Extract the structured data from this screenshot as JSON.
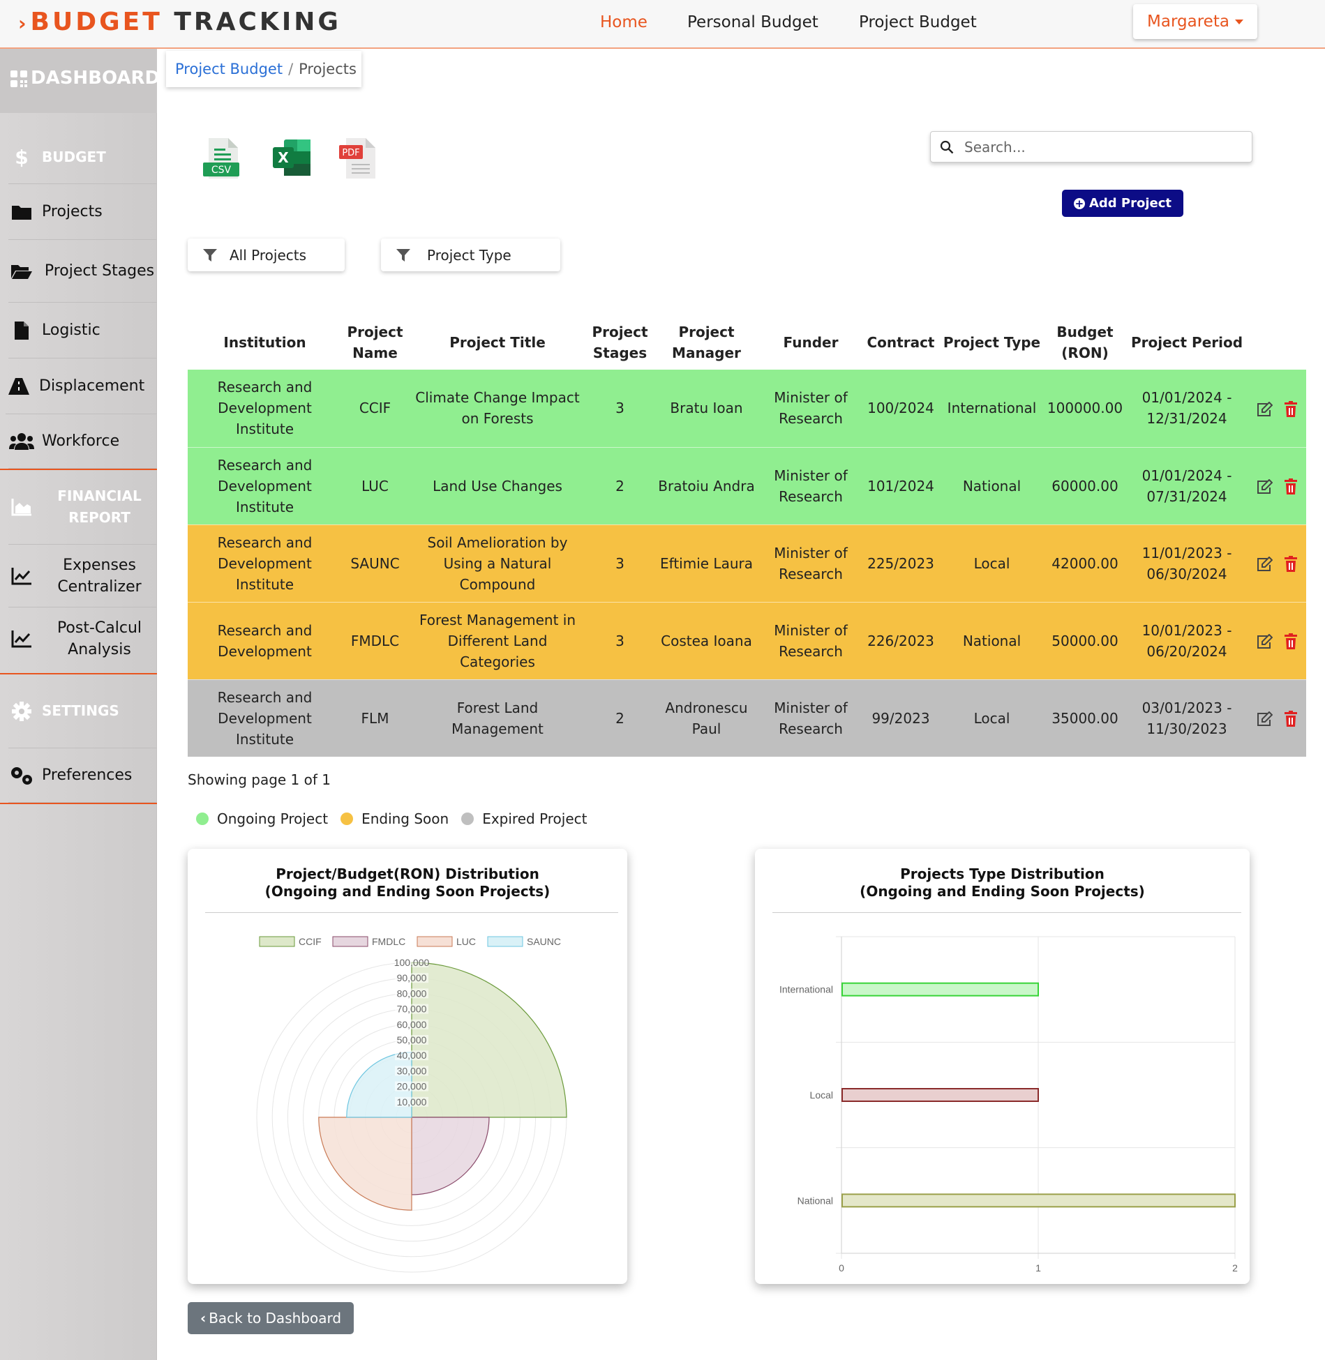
{
  "brand": {
    "prefix": "›",
    "part1": "BUDGET",
    "part2": "TRACKING"
  },
  "nav": {
    "home": "Home",
    "personal": "Personal Budget",
    "project": "Project Budget"
  },
  "user": {
    "name": "Margareta"
  },
  "sidebar": {
    "dashboard": "DASHBOARD",
    "budget_head": "BUDGET",
    "projects": "Projects",
    "project_stages": "Project Stages",
    "logistic": "Logistic",
    "displacement": "Displacement",
    "workforce": "Workforce",
    "financial_head": "FINANCIAL REPORT",
    "expenses": "Expenses Centralizer",
    "postcalc": "Post-Calcul Analysis",
    "settings_head": "SETTINGS",
    "preferences": "Preferences"
  },
  "breadcrumb": {
    "link": "Project Budget",
    "separator": "/",
    "current": "Projects"
  },
  "exports": {
    "csv": "CSV",
    "excel": "X",
    "pdf": "PDF"
  },
  "search": {
    "placeholder": "Search..."
  },
  "add_button": "Add Project",
  "filters": {
    "all": "All Projects",
    "type": "Project Type"
  },
  "table": {
    "headers": [
      "Institution",
      "Project Name",
      "Project Title",
      "Project Stages",
      "Project Manager",
      "Funder",
      "Contract",
      "Project Type",
      "Budget (RON)",
      "Project Period"
    ],
    "rows": [
      {
        "status": "green",
        "cells": [
          "Research and Development Institute",
          "CCIF",
          "Climate Change Impact on Forests",
          "3",
          "Bratu Ioan",
          "Minister of Research",
          "100/2024",
          "International",
          "100000.00",
          "01/01/2024 - 12/31/2024"
        ]
      },
      {
        "status": "green",
        "cells": [
          "Research and Development Institute",
          "LUC",
          "Land Use Changes",
          "2",
          "Bratoiu Andra",
          "Minister of Research",
          "101/2024",
          "National",
          "60000.00",
          "01/01/2024 - 07/31/2024"
        ]
      },
      {
        "status": "yellow",
        "cells": [
          "Research and Development Institute",
          "SAUNC",
          "Soil Amelioration by Using a Natural Compound",
          "3",
          "Eftimie Laura",
          "Minister of Research",
          "225/2023",
          "Local",
          "42000.00",
          "11/01/2023 - 06/30/2024"
        ]
      },
      {
        "status": "yellow",
        "cells": [
          "Research and Development",
          "FMDLC",
          "Forest Management in Different Land Categories",
          "3",
          "Costea Ioana",
          "Minister of Research",
          "226/2023",
          "National",
          "50000.00",
          "10/01/2023 - 06/20/2024"
        ]
      },
      {
        "status": "gray",
        "cells": [
          "Research and Development Institute",
          "FLM",
          "Forest Land Management",
          "2",
          "Andronescu Paul",
          "Minister of Research",
          "99/2023",
          "Local",
          "35000.00",
          "03/01/2023 - 11/30/2023"
        ]
      }
    ]
  },
  "showing": "Showing page 1 of 1",
  "status_legend": {
    "ongoing": "Ongoing Project",
    "ending": "Ending Soon",
    "expired": "Expired Project"
  },
  "colors": {
    "ongoing": "#90ee90",
    "ending": "#f6c143",
    "expired": "#bfbfbf",
    "accent": "#e8551f",
    "primary": "#0c0c86"
  },
  "back_button": "Back to Dashboard",
  "chart_data": [
    {
      "type": "polarArea",
      "title": "Project/Budget(RON) Distribution",
      "subtitle": "(Ongoing and Ending Soon Projects)",
      "categories": [
        "CCIF",
        "FMDLC",
        "LUC",
        "SAUNC"
      ],
      "values": [
        100000,
        50000,
        60000,
        42000
      ],
      "colors": [
        "#dde8c9",
        "#e6d6df",
        "#f6e0d6",
        "#d9f1f7"
      ],
      "border_colors": [
        "#6a9a3a",
        "#8a4a6a",
        "#c97a55",
        "#6ec6e0"
      ],
      "rlim": [
        0,
        100000
      ],
      "ticks": [
        10000,
        20000,
        30000,
        40000,
        50000,
        60000,
        70000,
        80000,
        90000,
        100000
      ],
      "tick_labels": [
        "10,000",
        "20,000",
        "30,000",
        "40,000",
        "50,000",
        "60,000",
        "70,000",
        "80,000",
        "90,000",
        "100,000"
      ],
      "legend": "top"
    },
    {
      "type": "bar",
      "orientation": "horizontal",
      "title": "Projects Type Distribution",
      "subtitle": "(Ongoing and Ending Soon Projects)",
      "categories": [
        "International",
        "Local",
        "National"
      ],
      "values": [
        1,
        1,
        2
      ],
      "colors": [
        "#c9f7c9",
        "#e9cfcf",
        "#e4e7c9"
      ],
      "border_colors": [
        "#37d437",
        "#8a2a2a",
        "#9aa04a"
      ],
      "xlim": [
        0,
        2
      ],
      "ticks": [
        "0",
        "1",
        "2"
      ],
      "grid": true
    }
  ]
}
